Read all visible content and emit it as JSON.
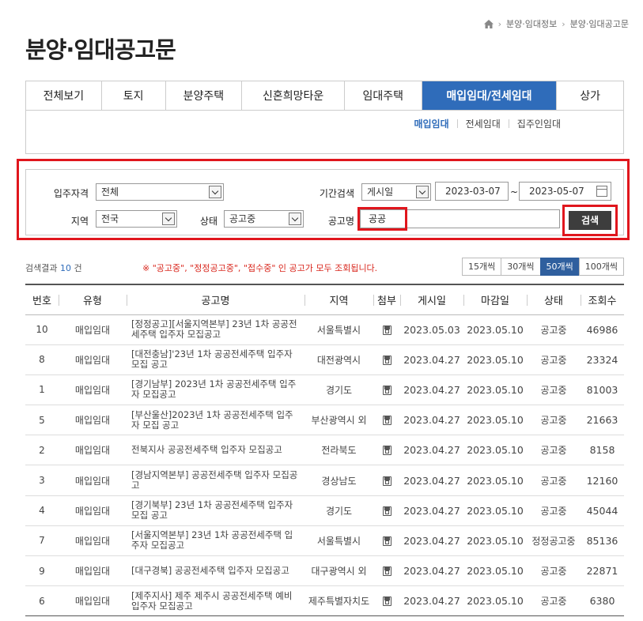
{
  "breadcrumb": [
    "분양·임대정보",
    "분양·임대공고문"
  ],
  "page_title": "분양·임대공고문",
  "tabs": [
    {
      "label": "전체보기",
      "active": false
    },
    {
      "label": "토지",
      "active": false
    },
    {
      "label": "분양주택",
      "active": false
    },
    {
      "label": "신혼희망타운",
      "active": false
    },
    {
      "label": "임대주택",
      "active": false
    },
    {
      "label": "매입임대/전세임대",
      "active": true
    },
    {
      "label": "상가",
      "active": false
    }
  ],
  "subtabs": [
    {
      "label": "매입임대",
      "active": true
    },
    {
      "label": "전세임대",
      "active": false
    },
    {
      "label": "집주인임대",
      "active": false
    }
  ],
  "search": {
    "qualification_label": "입주자격",
    "qualification_value": "전체",
    "period_label": "기간검색",
    "period_type_value": "게시일",
    "date_from": "2023-03-07",
    "date_tilde": "~",
    "date_to": "2023-05-07",
    "region_label": "지역",
    "region_value": "전국",
    "status_label": "상태",
    "status_value": "공고중",
    "name_label": "공고명",
    "name_value": "공공",
    "button_label": "검색"
  },
  "results": {
    "count_prefix": "검색결과",
    "count": "10",
    "count_suffix": "건",
    "notice": "※ \"공고중\", \"정정공고중\", \"접수중\" 인 공고가 모두 조회됩니다.",
    "per_page": [
      {
        "label": "15개씩",
        "active": false
      },
      {
        "label": "30개씩",
        "active": false
      },
      {
        "label": "50개씩",
        "active": true
      },
      {
        "label": "100개씩",
        "active": false
      }
    ]
  },
  "table": {
    "headers": [
      "번호",
      "유형",
      "공고명",
      "지역",
      "첨부",
      "게시일",
      "마감일",
      "상태",
      "조회수"
    ],
    "rows": [
      {
        "no": "10",
        "type": "매입임대",
        "title": "[정정공고][서울지역본부] 23년 1차 공공전세주택 입주자 모집공고",
        "region": "서울특별시",
        "posted": "2023.05.03",
        "deadline": "2023.05.10",
        "status": "공고중",
        "views": "46986"
      },
      {
        "no": "8",
        "type": "매입임대",
        "title": "[대전충남]'23년 1차 공공전세주택 입주자 모집 공고",
        "region": "대전광역시",
        "posted": "2023.04.27",
        "deadline": "2023.05.10",
        "status": "공고중",
        "views": "23324"
      },
      {
        "no": "1",
        "type": "매입임대",
        "title": "[경기남부] 2023년 1차 공공전세주택 입주자 모집공고",
        "region": "경기도",
        "posted": "2023.04.27",
        "deadline": "2023.05.10",
        "status": "공고중",
        "views": "81003"
      },
      {
        "no": "5",
        "type": "매입임대",
        "title": "[부산울산]2023년 1차 공공전세주택 입주자 모집 공고",
        "region": "부산광역시 외",
        "posted": "2023.04.27",
        "deadline": "2023.05.10",
        "status": "공고중",
        "views": "21663"
      },
      {
        "no": "2",
        "type": "매입임대",
        "title": "전북지사 공공전세주택 입주자 모집공고",
        "region": "전라북도",
        "posted": "2023.04.27",
        "deadline": "2023.05.10",
        "status": "공고중",
        "views": "8158"
      },
      {
        "no": "3",
        "type": "매입임대",
        "title": "[경남지역본부] 공공전세주택 입주자 모집공고",
        "region": "경상남도",
        "posted": "2023.04.27",
        "deadline": "2023.05.10",
        "status": "공고중",
        "views": "12160"
      },
      {
        "no": "4",
        "type": "매입임대",
        "title": "[경기북부] 23년 1차 공공전세주택 입주자 모집 공고",
        "region": "경기도",
        "posted": "2023.04.27",
        "deadline": "2023.05.10",
        "status": "공고중",
        "views": "45044"
      },
      {
        "no": "7",
        "type": "매입임대",
        "title": "[서울지역본부] 23년 1차 공공전세주택 입주자 모집공고",
        "region": "서울특별시",
        "posted": "2023.04.27",
        "deadline": "2023.05.10",
        "status": "정정공고중",
        "views": "85136"
      },
      {
        "no": "9",
        "type": "매입임대",
        "title": "[대구경북] 공공전세주택 입주자 모집공고",
        "region": "대구광역시 외",
        "posted": "2023.04.27",
        "deadline": "2023.05.10",
        "status": "공고중",
        "views": "22871"
      },
      {
        "no": "6",
        "type": "매입임대",
        "title": "[제주지사] 제주 제주시 공공전세주택 예비입주자 모집공고",
        "region": "제주특별자치도",
        "posted": "2023.04.27",
        "deadline": "2023.05.10",
        "status": "공고중",
        "views": "6380"
      }
    ]
  },
  "colors": {
    "accent": "#2f6cba",
    "highlight": "#e0161d",
    "notice": "#d9261c",
    "button": "#3d3d3d"
  },
  "icons": {
    "home": "home-icon",
    "attach": "file-icon",
    "calendar": "calendar-icon"
  }
}
